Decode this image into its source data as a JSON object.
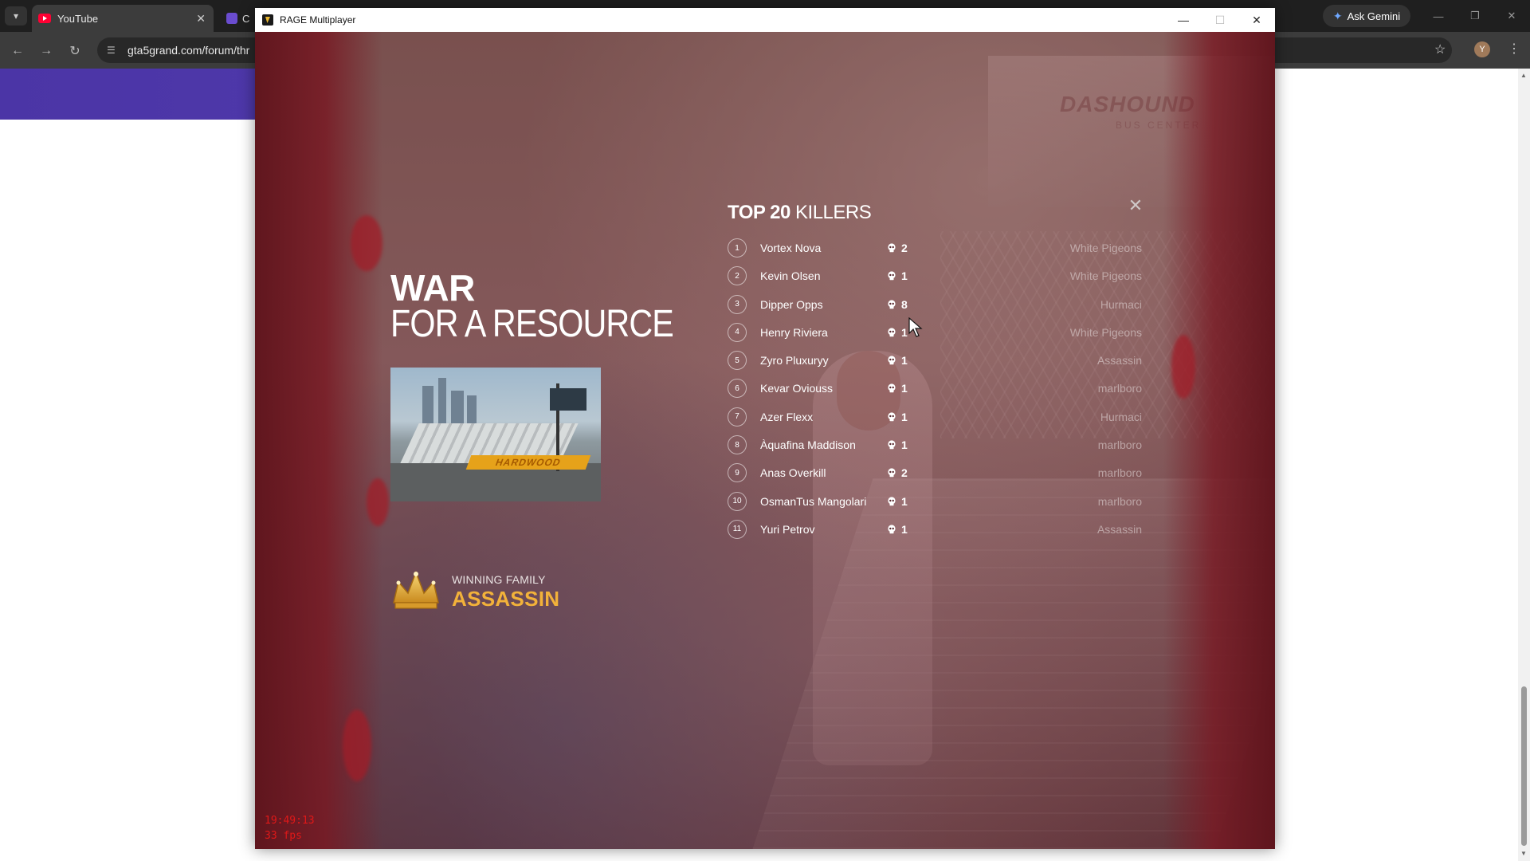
{
  "browser": {
    "tab_title": "YouTube",
    "tab_close": "✕",
    "tab2_title": "C",
    "url": "gta5grand.com/forum/thr",
    "gemini_label": "Ask Gemini",
    "profile_initial": "Y"
  },
  "rage_window": {
    "title": "RAGE Multiplayer",
    "minimize": "—",
    "maximize": "☐",
    "close": "✕"
  },
  "event": {
    "title_line1": "WAR",
    "title_line2": "FOR A RESOURCE",
    "image_sign_text": "HARDWOOD",
    "winning_label": "WINNING FAMILY",
    "winning_family": "ASSASSIN"
  },
  "killers": {
    "header_bold": "TOP 20",
    "header_rest": "KILLERS",
    "close_label": "✕",
    "rows": [
      {
        "rank": "1",
        "name": "Vortex Nova",
        "kills": "2",
        "family": "White Pigeons"
      },
      {
        "rank": "2",
        "name": "Kevin Olsen",
        "kills": "1",
        "family": "White Pigeons"
      },
      {
        "rank": "3",
        "name": "Dipper Opps",
        "kills": "8",
        "family": "Hurmaci"
      },
      {
        "rank": "4",
        "name": "Henry Riviera",
        "kills": "1",
        "family": "White Pigeons"
      },
      {
        "rank": "5",
        "name": "Zyro Pluxuryy",
        "kills": "1",
        "family": "Assassin"
      },
      {
        "rank": "6",
        "name": "Kevar Oviouss",
        "kills": "1",
        "family": "marlboro"
      },
      {
        "rank": "7",
        "name": "Azer Flexx",
        "kills": "1",
        "family": "Hurmaci"
      },
      {
        "rank": "8",
        "name": "Àquafina Maddison",
        "kills": "1",
        "family": "marlboro"
      },
      {
        "rank": "9",
        "name": "Anas Overkill",
        "kills": "2",
        "family": "marlboro"
      },
      {
        "rank": "10",
        "name": "OsmanTus Mangolari",
        "kills": "1",
        "family": "marlboro"
      },
      {
        "rank": "11",
        "name": "Yuri Petrov",
        "kills": "1",
        "family": "Assassin"
      }
    ]
  },
  "debug": {
    "time": "19:49:13",
    "fps": "33 fps"
  }
}
